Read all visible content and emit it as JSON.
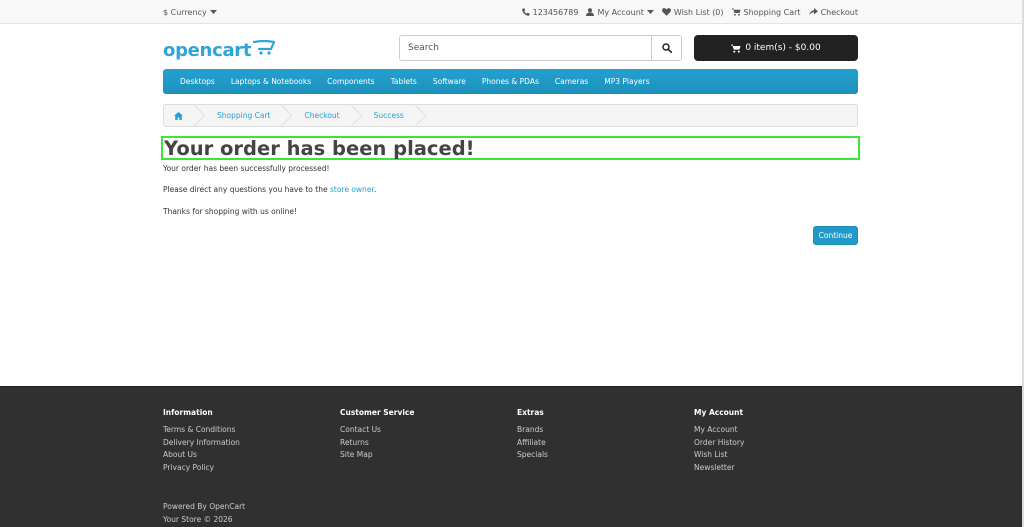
{
  "topbar": {
    "currency": "$ Currency",
    "phone": "123456789",
    "my_account": "My Account",
    "wish_list": "Wish List (0)",
    "shopping_cart": "Shopping Cart",
    "checkout": "Checkout"
  },
  "header": {
    "logo": "opencart",
    "search_placeholder": "Search",
    "cart_label": "0 item(s) - $0.00"
  },
  "menu": [
    "Desktops",
    "Laptops & Notebooks",
    "Components",
    "Tablets",
    "Software",
    "Phones & PDAs",
    "Cameras",
    "MP3 Players"
  ],
  "breadcrumb": [
    "Shopping Cart",
    "Checkout",
    "Success"
  ],
  "content": {
    "title": "Your order has been placed!",
    "line1": "Your order has been successfully processed!",
    "line2_prefix": "Please direct any questions you have to the ",
    "line2_link": "store owner",
    "line2_suffix": ".",
    "line3": "Thanks for shopping with us online!",
    "continue_label": "Continue"
  },
  "footer": {
    "columns": [
      {
        "title": "Information",
        "links": [
          "Terms & Conditions",
          "Delivery Information",
          "About Us",
          "Privacy Policy"
        ]
      },
      {
        "title": "Customer Service",
        "links": [
          "Contact Us",
          "Returns",
          "Site Map"
        ]
      },
      {
        "title": "Extras",
        "links": [
          "Brands",
          "Affiliate",
          "Specials"
        ]
      },
      {
        "title": "My Account",
        "links": [
          "My Account",
          "Order History",
          "Wish List",
          "Newsletter"
        ]
      }
    ],
    "powered": "Powered By OpenCart",
    "copyright": "Your Store © 2026"
  },
  "colors": {
    "accent": "#23a1d1",
    "cart_bg": "#222222",
    "footer_bg": "#303030",
    "highlight": "#39e639"
  }
}
